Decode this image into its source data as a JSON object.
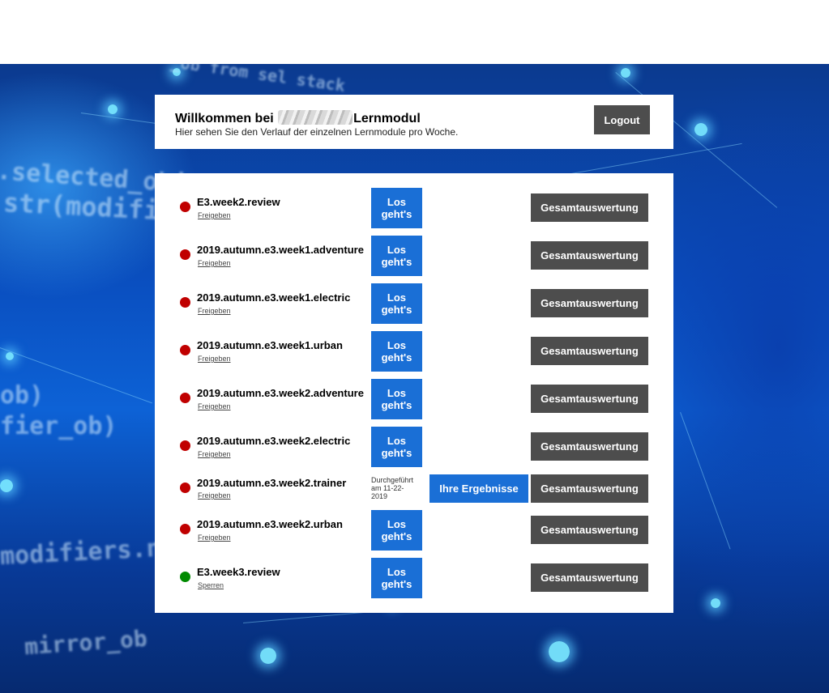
{
  "header": {
    "title_prefix": "Willkommen bei",
    "title_suffix": "Lernmodul",
    "subtitle": "Hier sehen Sie den Verlauf der einzelnen Lernmodule pro Woche.",
    "logout_label": "Logout"
  },
  "modules": [
    {
      "title": "E3.week2.review",
      "status": "red",
      "link": "Freigeben",
      "go_line1": "Los",
      "go_line2": "geht's",
      "total_label": "Gesamtauswertung"
    },
    {
      "title": "2019.autumn.e3.week1.adventure",
      "status": "red",
      "link": "Freigeben",
      "go_line1": "Los",
      "go_line2": "geht's",
      "total_label": "Gesamtauswertung"
    },
    {
      "title": "2019.autumn.e3.week1.electric",
      "status": "red",
      "link": "Freigeben",
      "go_line1": "Los",
      "go_line2": "geht's",
      "total_label": "Gesamtauswertung"
    },
    {
      "title": "2019.autumn.e3.week1.urban",
      "status": "red",
      "link": "Freigeben",
      "go_line1": "Los",
      "go_line2": "geht's",
      "total_label": "Gesamtauswertung"
    },
    {
      "title": "2019.autumn.e3.week2.adventure",
      "status": "red",
      "link": "Freigeben",
      "go_line1": "Los",
      "go_line2": "geht's",
      "total_label": "Gesamtauswertung"
    },
    {
      "title": "2019.autumn.e3.week2.electric",
      "status": "red",
      "link": "Freigeben",
      "go_line1": "Los",
      "go_line2": "geht's",
      "total_label": "Gesamtauswertung"
    },
    {
      "title": "2019.autumn.e3.week2.trainer",
      "status": "red",
      "link": "Freigeben",
      "done_line1": "Durchgeführt",
      "done_line2": "am 11-22-",
      "done_line3": "2019",
      "result_label": "Ihre Ergebnisse",
      "total_label": "Gesamtauswertung"
    },
    {
      "title": "2019.autumn.e3.week2.urban",
      "status": "red",
      "link": "Freigeben",
      "go_line1": "Los",
      "go_line2": "geht's",
      "total_label": "Gesamtauswertung"
    },
    {
      "title": "E3.week3.review",
      "status": "green",
      "link": "Sperren",
      "go_line1": "Los",
      "go_line2": "geht's",
      "total_label": "Gesamtauswertung"
    }
  ],
  "colors": {
    "status_red": "#c00000",
    "status_green": "#008a00",
    "primary_button": "#1a6fd6",
    "dark_button": "#4d4d4d"
  },
  "background_code": [
    ".selected_obj",
    "str(modifier",
    "ob)",
    "fier_ob)",
    "modifiers.new",
    "mirror_ob",
    "_ob from sel stack"
  ]
}
